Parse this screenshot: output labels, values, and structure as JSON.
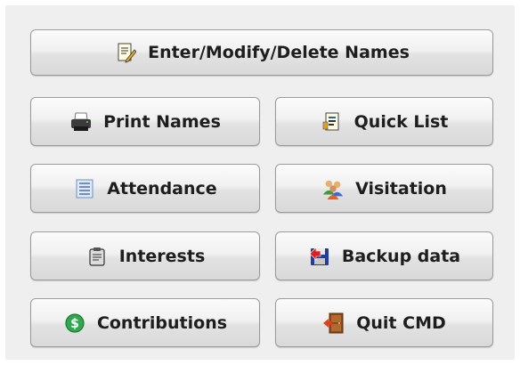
{
  "buttons": {
    "names": {
      "label": "Enter/Modify/Delete Names",
      "icon": "edit-document-icon"
    },
    "print": {
      "label": "Print Names",
      "icon": "printer-icon"
    },
    "quicklist": {
      "label": "Quick List",
      "icon": "document-list-icon"
    },
    "attendance": {
      "label": "Attendance",
      "icon": "list-icon"
    },
    "visitation": {
      "label": "Visitation",
      "icon": "people-icon"
    },
    "interests": {
      "label": "Interests",
      "icon": "clipboard-icon"
    },
    "backup": {
      "label": "Backup data",
      "icon": "floppy-disk-icon"
    },
    "contributions": {
      "label": "Contributions",
      "icon": "dollar-coin-icon"
    },
    "quit": {
      "label": "Quit CMD",
      "icon": "exit-door-icon"
    }
  }
}
